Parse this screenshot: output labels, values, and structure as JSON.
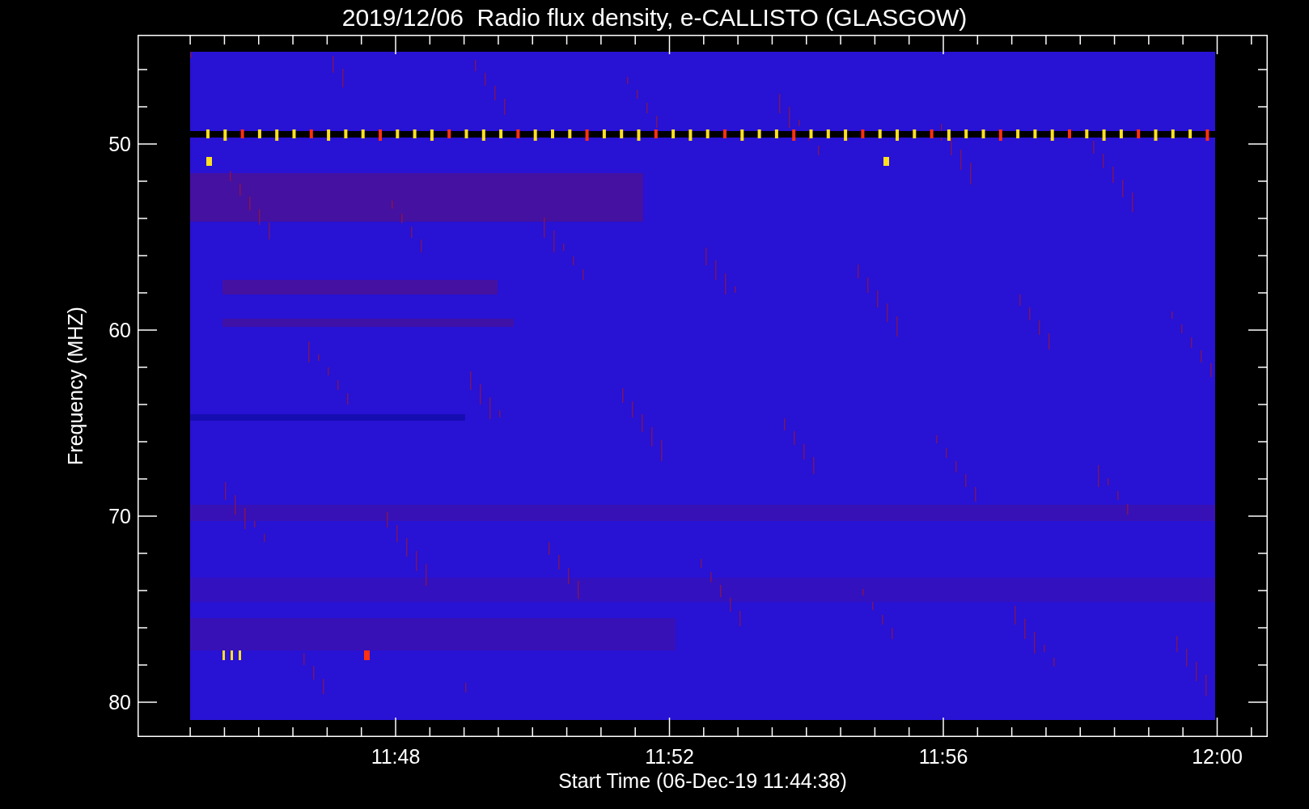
{
  "title": "2019/12/06  Radio flux density, e-CALLISTO (GLASGOW)",
  "y_axis": {
    "label": "Frequency (MHZ)",
    "tick_labels": [
      "50",
      "60",
      "70",
      "80"
    ]
  },
  "x_axis": {
    "label": "Start Time (06-Dec-19 11:44:38)",
    "tick_labels": [
      "11:48",
      "11:52",
      "11:56",
      "12:00"
    ]
  }
}
